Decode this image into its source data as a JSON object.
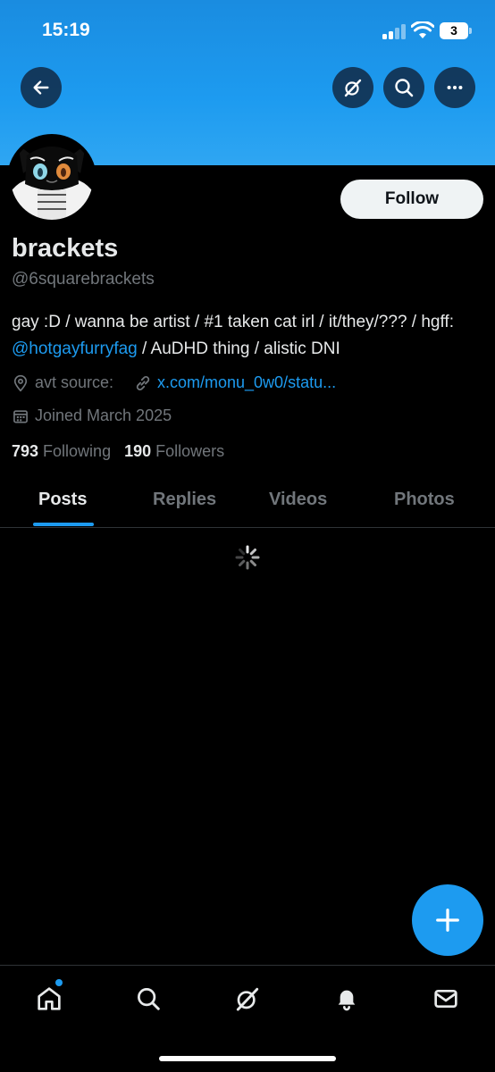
{
  "status_bar": {
    "time": "15:19",
    "battery_level": "3"
  },
  "header": {
    "back_icon": "arrow-left-icon",
    "grok_icon": "grok-icon",
    "search_icon": "search-icon",
    "more_icon": "more-horizontal-icon"
  },
  "profile": {
    "follow_label": "Follow",
    "display_name": "brackets",
    "handle": "@6squarebrackets",
    "bio_before": "gay :D / wanna be artist / #1 taken cat irl / it/they/??? / hgff: ",
    "bio_mention": "@hotgayfurryfag",
    "bio_after": " / AuDHD thing / alistic DNI",
    "location": "avt source:",
    "link": "x.com/monu_0w0/statu...",
    "joined": "Joined March 2025",
    "following_count": "793",
    "following_label": "Following",
    "followers_count": "190",
    "followers_label": "Followers"
  },
  "tabs": [
    {
      "label": "Posts",
      "active": true
    },
    {
      "label": "Replies",
      "active": false
    },
    {
      "label": "Videos",
      "active": false
    },
    {
      "label": "Photos",
      "active": false
    }
  ],
  "bottom_nav": [
    "home-icon",
    "search-icon",
    "grok-icon",
    "notifications-icon",
    "messages-icon"
  ],
  "colors": {
    "accent": "#1d9bf0",
    "background": "#000000",
    "primary_text": "#e7e9ea",
    "secondary_text": "#71767b"
  }
}
